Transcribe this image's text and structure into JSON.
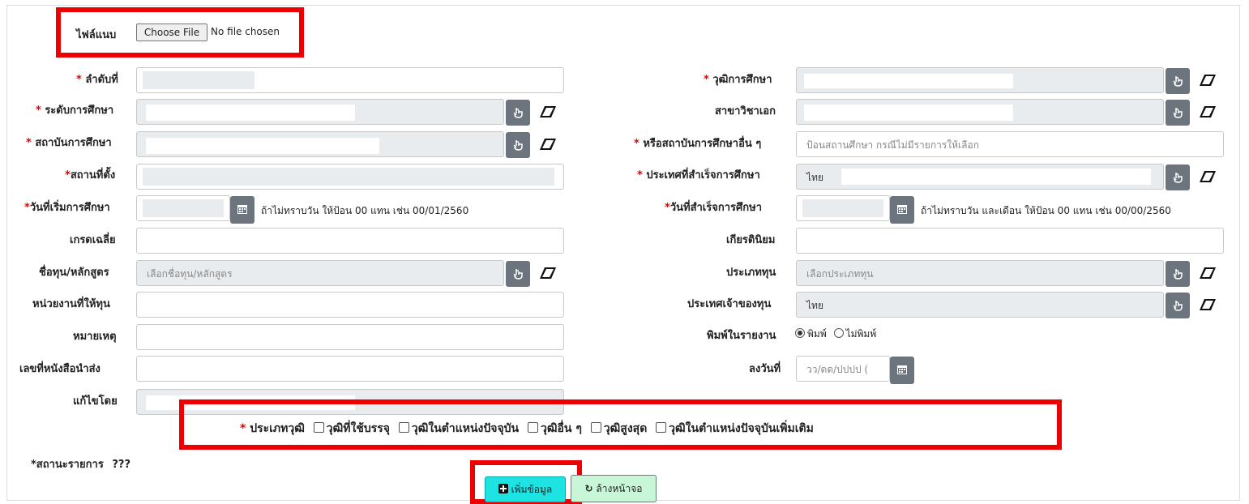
{
  "attachment": {
    "label": "ไฟล์แนบ",
    "button": "Choose File",
    "status": "No file chosen"
  },
  "left_fields": {
    "order": "ลำดับที่",
    "level": "ระดับการศึกษา",
    "institution": "สถาบันการศึกษา",
    "location": "สถานที่ตั้ง",
    "start_date": "วันที่เริ่มการศึกษา",
    "start_hint": "ถ้าไม่ทราบวัน ให้ป้อน 00 แทน เช่น 00/01/2560",
    "gpa": "เกรดเฉลี่ย",
    "scholarship": "ชื่อทุน/หลักสูตร",
    "scholarship_placeholder": "เลือกชื่อทุน/หลักสูตร",
    "funding_agency": "หน่วยงานที่ให้ทุน",
    "note": "หมายเหตุ",
    "letter_no": "เลขที่หนังสือนำส่ง",
    "edited_by": "แก้ไขโดย"
  },
  "right_fields": {
    "degree": "วุฒิการศึกษา",
    "major": "สาขาวิชาเอก",
    "other_institution": "หรือสถาบันการศึกษาอื่น ๆ",
    "other_institution_placeholder": "ป้อนสถานศึกษา กรณีไม่มีรายการให้เลือก",
    "country_graduated": "ประเทศที่สำเร็จการศึกษา",
    "country_graduated_value": "ไทย",
    "end_date": "วันที่สำเร็จการศึกษา",
    "end_hint": "ถ้าไม่ทราบวัน และเดือน ให้ป้อน 00 แทน เช่น 00/00/2560",
    "honors": "เกียรตินิยม",
    "scholarship_type": "ประเภททุน",
    "scholarship_type_placeholder": "เลือกประเภททุน",
    "scholarship_country": "ประเทศเจ้าของทุน",
    "scholarship_country_value": "ไทย",
    "print_in_report": "พิมพ์ในรายงาน",
    "print_option": "พิมพ์",
    "no_print_option": "ไม่พิมพ์",
    "signed_date": "ลงวันที่",
    "signed_date_placeholder": "วว/ดด/ปปปป ("
  },
  "qualification_type": {
    "label": "ประเภทวุฒิ",
    "options": [
      "วุฒิที่ใช้บรรจุ",
      "วุฒิในตำแหน่งปัจจุบัน",
      "วุฒิอื่น ๆ",
      "วุฒิสูงสุด",
      "วุฒิในตำแหน่งปัจจุบันเพิ่มเติม"
    ]
  },
  "status": {
    "label": "*สถานะรายการ",
    "value": "???"
  },
  "actions": {
    "add": "เพิ่มข้อมูล",
    "clear": "ล้างหน้าจอ"
  },
  "colors": {
    "highlight": "#ee0000",
    "add_button": "#1ee3e3",
    "clear_button": "#c8f7d8",
    "icon_button": "#6c757d",
    "required": "#e60000"
  }
}
